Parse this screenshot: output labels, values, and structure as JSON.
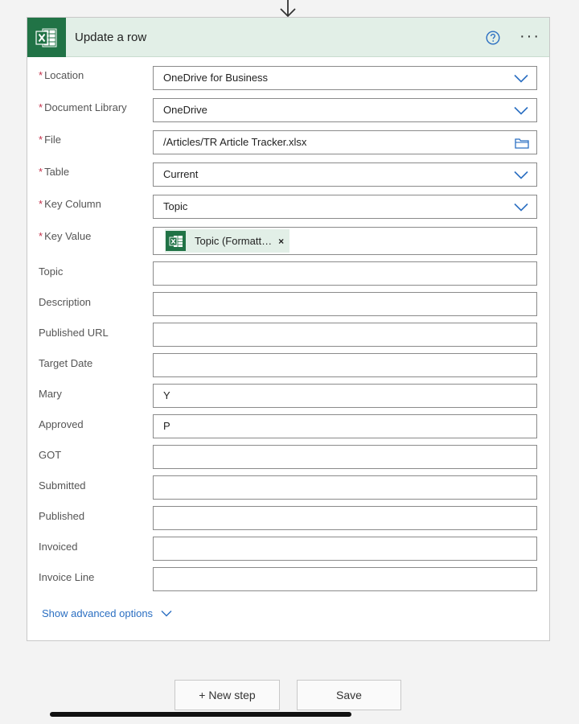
{
  "card": {
    "title": "Update a row",
    "help_icon": "help-circle-icon",
    "more_icon": "more-icon",
    "more_label": "···"
  },
  "required_marker": "*",
  "fields": {
    "location": {
      "label": "Location",
      "value": "OneDrive for Business"
    },
    "document_library": {
      "label": "Document Library",
      "value": "OneDrive"
    },
    "file": {
      "label": "File",
      "value": "/Articles/TR Article Tracker.xlsx"
    },
    "table": {
      "label": "Table",
      "value": "Current"
    },
    "key_column": {
      "label": "Key Column",
      "value": "Topic"
    },
    "key_value": {
      "label": "Key Value",
      "token": "Topic (Formatt…",
      "token_remove": "×"
    },
    "topic": {
      "label": "Topic",
      "value": ""
    },
    "description": {
      "label": "Description",
      "value": ""
    },
    "published_url": {
      "label": "Published URL",
      "value": ""
    },
    "target_date": {
      "label": "Target Date",
      "value": ""
    },
    "mary": {
      "label": "Mary",
      "value": "Y"
    },
    "approved": {
      "label": "Approved",
      "value": "P"
    },
    "got": {
      "label": "GOT",
      "value": ""
    },
    "submitted": {
      "label": "Submitted",
      "value": ""
    },
    "published": {
      "label": "Published",
      "value": ""
    },
    "invoiced": {
      "label": "Invoiced",
      "value": ""
    },
    "invoice_line": {
      "label": "Invoice Line",
      "value": ""
    }
  },
  "advanced_label": "Show advanced options",
  "buttons": {
    "new_step": "+ New step",
    "save": "Save"
  },
  "colors": {
    "excel_green": "#217346",
    "header_bg": "#e2efe7",
    "link_blue": "#2b6fc2",
    "required_red": "#c4314b"
  }
}
